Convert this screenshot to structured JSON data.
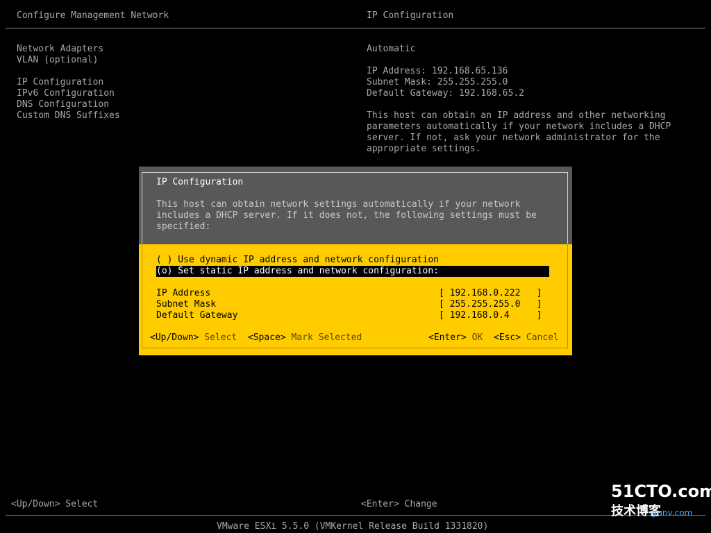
{
  "header": {
    "left_title": "Configure Management Network",
    "right_title": "IP Configuration"
  },
  "menu": {
    "items": [
      "Network Adapters",
      "VLAN (optional)",
      "IP Configuration",
      "IPv6 Configuration",
      "DNS Configuration",
      "Custom DNS Suffixes"
    ]
  },
  "right_panel": {
    "mode": "Automatic",
    "ip": "IP Address: 192.168.65.136",
    "mask": "Subnet Mask: 255.255.255.0",
    "gateway": "Default Gateway: 192.168.65.2",
    "description": "This host can obtain an IP address and other networking parameters automatically if your network includes a DHCP server. If not, ask your network administrator for the appropriate settings."
  },
  "dialog": {
    "title": "IP Configuration",
    "description": "This host can obtain network settings automatically if your network includes a DHCP server. If it does not, the following settings must be specified:",
    "options": {
      "dynamic": "( ) Use dynamic IP address and network configuration",
      "static": "(o) Set static IP address and network configuration:"
    },
    "fields": {
      "ip_label": "IP Address",
      "ip_value": "[ 192.168.0.222   ]",
      "mask_label": "Subnet Mask",
      "mask_value": "[ 255.255.255.0   ]",
      "gateway_label": "Default Gateway",
      "gateway_value": "[ 192.168.0.4     ]"
    },
    "hints": {
      "updown_key": "<Up/Down>",
      "updown_action": "Select",
      "space_key": "<Space>",
      "space_action": "Mark Selected",
      "enter_key": "<Enter>",
      "enter_action": "OK",
      "esc_key": "<Esc>",
      "esc_action": "Cancel"
    }
  },
  "footer": {
    "left_key": "<Up/Down>",
    "left_action": "Select",
    "mid_key": "<Enter>",
    "mid_action": "Change",
    "version": "VMware ESXi 5.5.0 (VMKernel Release Build 1331820)"
  },
  "watermark": {
    "logo": "51CTO.com",
    "line1": "技术博客",
    "line2": "iyunv.com"
  },
  "colors": {
    "background": "#000000",
    "dialog_accent": "#ffcc00",
    "dialog_header": "#585858",
    "text": "#a8a8a8"
  }
}
